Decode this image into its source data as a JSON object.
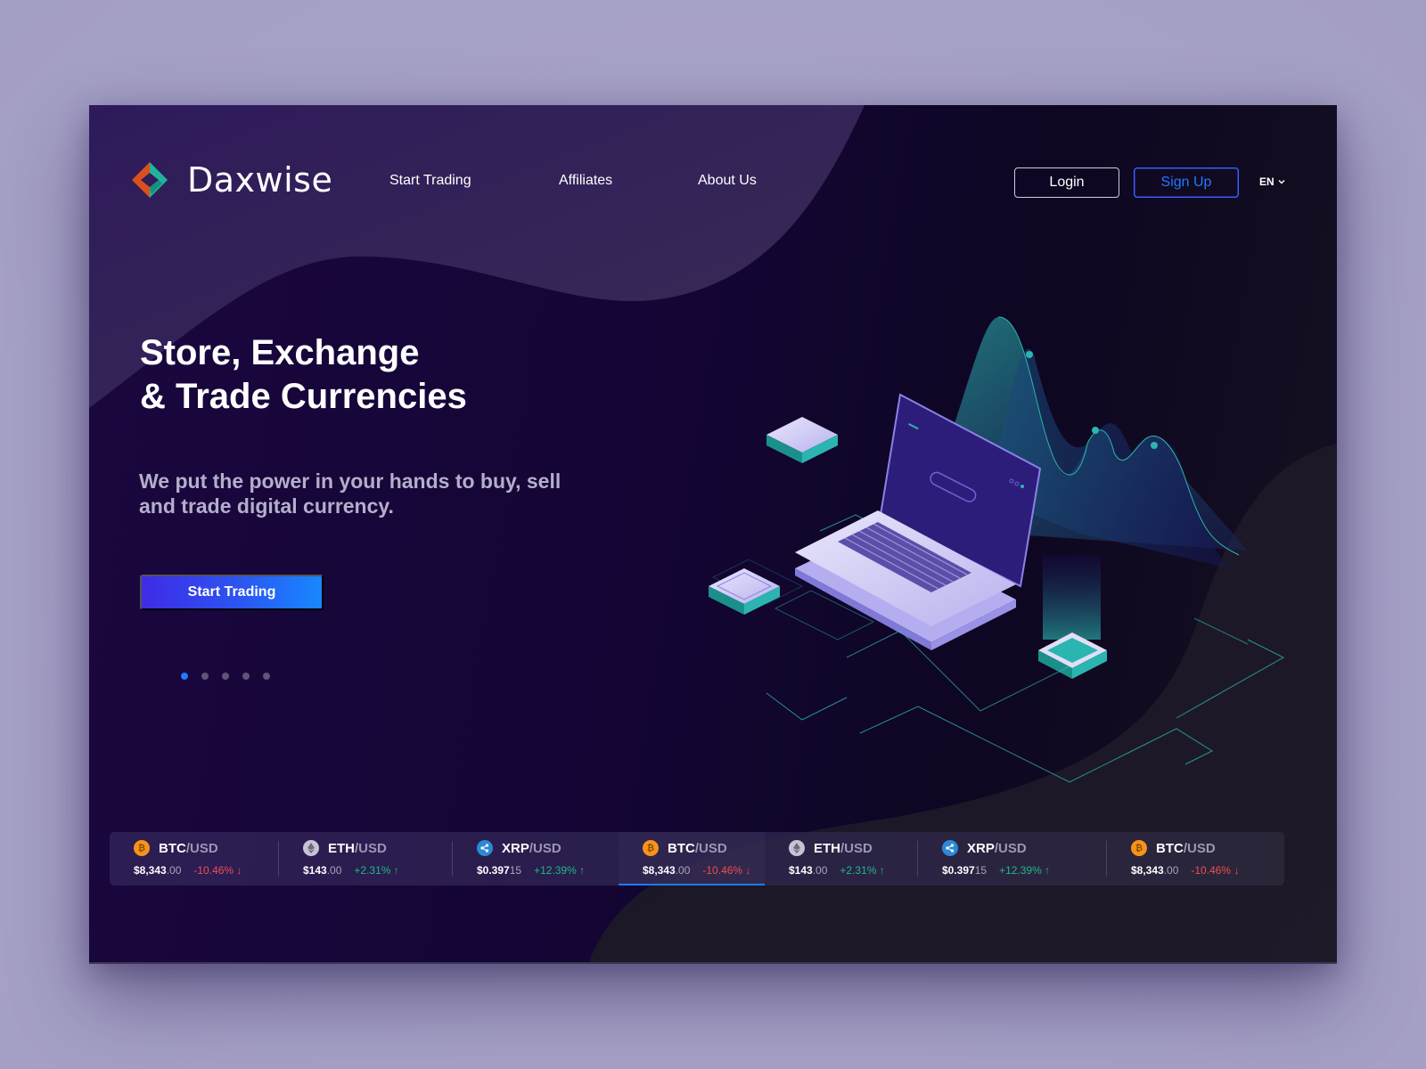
{
  "brand": {
    "name": "Daxwise",
    "logo_icon": "diamond-logo-icon"
  },
  "nav": {
    "links": [
      {
        "label": "Start Trading"
      },
      {
        "label": "Affiliates"
      },
      {
        "label": "About Us"
      }
    ],
    "login_label": "Login",
    "signup_label": "Sign Up",
    "language": "EN",
    "language_icon": "chevron-down-icon"
  },
  "hero": {
    "title": "Store, Exchange\n& Trade Currencies",
    "subtitle": "We put the power in your hands to buy, sell and trade digital currency.",
    "cta_label": "Start Trading",
    "slides_total": 5,
    "slide_active": 1,
    "illustration": "isometric-laptop-with-charts"
  },
  "colors": {
    "accent_blue": "#1d7bff",
    "cta_gradient_start": "#3f2be6",
    "cta_gradient_end": "#1788ff",
    "price_down": "#ef4e55",
    "price_up": "#1fb887",
    "illustration_teal": "#2bb5b0",
    "background_dark": "#140535"
  },
  "ticker": [
    {
      "coin": "BTC",
      "icon": "bitcoin-icon",
      "base": "BTC",
      "quote": "/USD",
      "price_main": "$8,343",
      "price_dec": ".00",
      "change": "-10.46%",
      "direction": "down",
      "arrow": "↓",
      "active": false
    },
    {
      "coin": "ETH",
      "icon": "ethereum-icon",
      "base": "ETH",
      "quote": "/USD",
      "price_main": "$143",
      "price_dec": ".00",
      "change": "+2.31%",
      "direction": "up",
      "arrow": "↑",
      "active": false
    },
    {
      "coin": "XRP",
      "icon": "ripple-icon",
      "base": "XRP",
      "quote": "/USD",
      "price_main": "$0.397",
      "price_dec": "15",
      "change": "+12.39%",
      "direction": "up",
      "arrow": "↑",
      "active": false
    },
    {
      "coin": "BTC",
      "icon": "bitcoin-icon",
      "base": "BTC",
      "quote": "/USD",
      "price_main": "$8,343",
      "price_dec": ".00",
      "change": "-10.46%",
      "direction": "down",
      "arrow": "↓",
      "active": true
    },
    {
      "coin": "ETH",
      "icon": "ethereum-icon",
      "base": "ETH",
      "quote": "/USD",
      "price_main": "$143",
      "price_dec": ".00",
      "change": "+2.31%",
      "direction": "up",
      "arrow": "↑",
      "active": false
    },
    {
      "coin": "XRP",
      "icon": "ripple-icon",
      "base": "XRP",
      "quote": "/USD",
      "price_main": "$0.397",
      "price_dec": "15",
      "change": "+12.39%",
      "direction": "up",
      "arrow": "↑",
      "active": false
    },
    {
      "coin": "BTC",
      "icon": "bitcoin-icon",
      "base": "BTC",
      "quote": "/USD",
      "price_main": "$8,343",
      "price_dec": ".00",
      "change": "-10.46%",
      "direction": "down",
      "arrow": "↓",
      "active": false
    }
  ]
}
